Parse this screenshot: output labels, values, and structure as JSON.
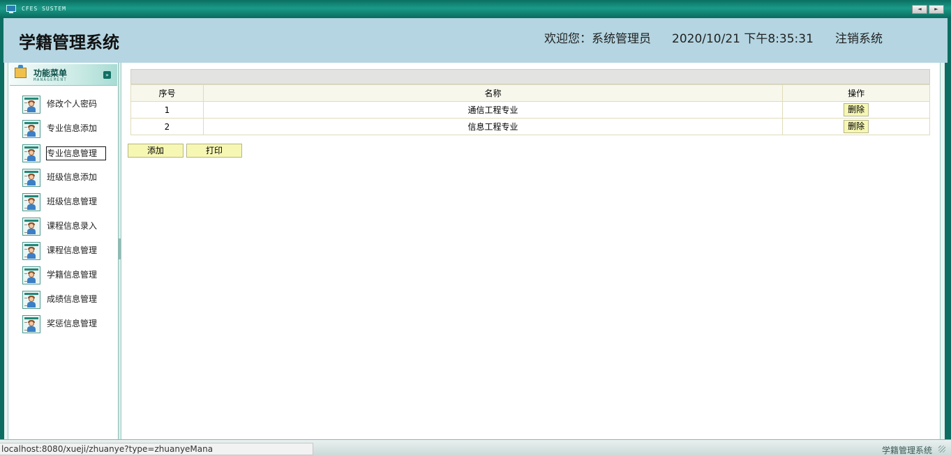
{
  "window": {
    "system_name": "CFES SUSTEM",
    "nav_prev": "◄",
    "nav_next": "►"
  },
  "header": {
    "title": "学籍管理系统",
    "welcome": "欢迎您：系统管理员",
    "datetime": "2020/10/21 下午8:35:31",
    "logout": "注销系统"
  },
  "sidebar": {
    "head_title": "功能菜单",
    "head_subtitle": "MANAGEMENT",
    "collapse_glyph": "»",
    "items": [
      {
        "label": "修改个人密码"
      },
      {
        "label": "专业信息添加"
      },
      {
        "label": "专业信息管理"
      },
      {
        "label": "班级信息添加"
      },
      {
        "label": "班级信息管理"
      },
      {
        "label": "课程信息录入"
      },
      {
        "label": "课程信息管理"
      },
      {
        "label": "学籍信息管理"
      },
      {
        "label": "成绩信息管理"
      },
      {
        "label": "奖惩信息管理"
      }
    ],
    "active_index": 2
  },
  "table": {
    "headers": [
      "序号",
      "名称",
      "操作"
    ],
    "rows": [
      {
        "index": "1",
        "name": "通信工程专业",
        "action": "删除"
      },
      {
        "index": "2",
        "name": "信息工程专业",
        "action": "删除"
      }
    ]
  },
  "actions": {
    "add": "添加",
    "print": "打印"
  },
  "footer": {
    "text": "学籍管理系统"
  },
  "status_url": "localhost:8080/xueji/zhuanye?type=zhuanyeMana"
}
